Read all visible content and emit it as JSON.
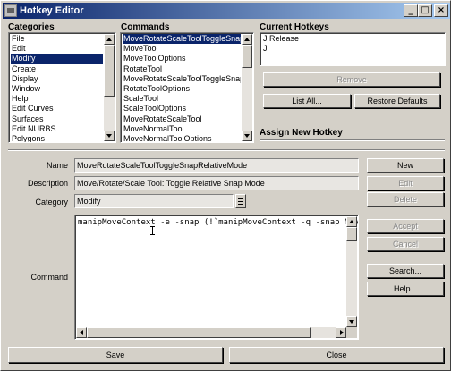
{
  "window": {
    "title": "Hotkey Editor",
    "minimize_glyph": "_",
    "maximize_glyph": "□",
    "close_glyph": "×"
  },
  "categories": {
    "header": "Categories",
    "items": [
      "File",
      "Edit",
      "Modify",
      "Create",
      "Display",
      "Window",
      "Help",
      "Edit Curves",
      "Surfaces",
      "Edit NURBS",
      "Polygons"
    ],
    "selected": "Modify"
  },
  "commands": {
    "header": "Commands",
    "items": [
      "MoveRotateScaleToolToggleSnapRelativeMode",
      "MoveTool",
      "MoveToolOptions",
      "RotateTool",
      "MoveRotateScaleToolToggleSnapRelativeMode",
      "RotateToolOptions",
      "ScaleTool",
      "ScaleToolOptions",
      "MoveRotateScaleTool",
      "MoveNormalTool",
      "MoveNormalToolOptions"
    ],
    "selected_index": 0
  },
  "current_hotkeys": {
    "header": "Current Hotkeys",
    "items": [
      "J Release",
      "J"
    ]
  },
  "buttons": {
    "remove": "Remove",
    "list_all": "List All...",
    "restore_defaults": "Restore Defaults",
    "new": "New",
    "edit": "Edit",
    "delete": "Delete",
    "accept": "Accept",
    "cancel": "Cancel",
    "search": "Search...",
    "help": "Help...",
    "save": "Save",
    "close": "Close"
  },
  "assign": {
    "header": "Assign New Hotkey"
  },
  "form": {
    "name_label": "Name",
    "name_value": "MoveRotateScaleToolToggleSnapRelativeMode",
    "description_label": "Description",
    "description_value": "Move/Rotate/Scale Tool: Toggle Relative Snap Mode",
    "category_label": "Category",
    "category_value": "Modify",
    "command_label": "Command",
    "command_value": "manipMoveContext -e -snap (!`manipMoveContext -q -snap Move`) Move;"
  }
}
